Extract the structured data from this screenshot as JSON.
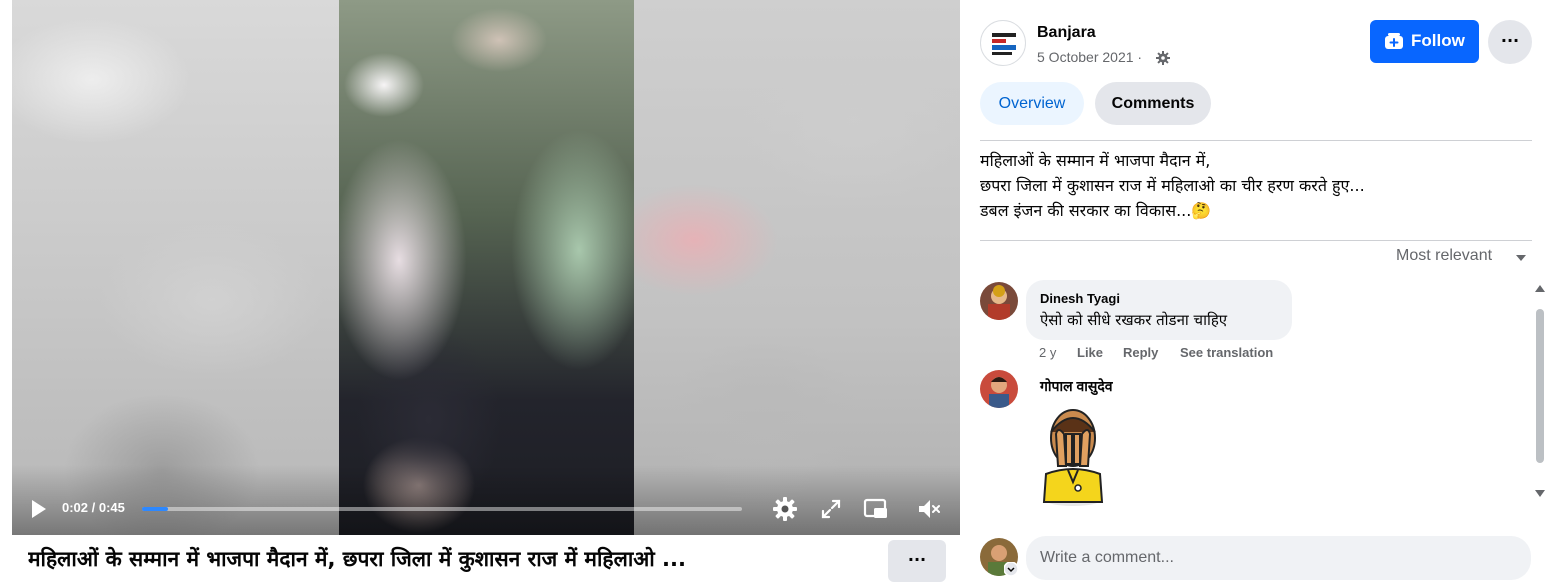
{
  "video": {
    "time_label": "0:02 / 0:45",
    "current_seconds": 2,
    "duration_seconds": 45,
    "progress_fraction": 0.044,
    "icons": [
      "play-icon",
      "settings-gear-icon",
      "fullscreen-icon",
      "picture-in-picture-icon",
      "muted-volume-icon"
    ]
  },
  "post": {
    "title": "महिलाओं के सम्मान में भाजपा मैदान में, छपरा जिला में कुशासन राज में महिलाओ ...",
    "title_more_label": "···",
    "page_name": "Banjara",
    "date": "5 October 2021 ·",
    "follow_label": "Follow",
    "more_label": "···",
    "caption_lines": [
      "महिलाओं के सम्मान में भाजपा मैदान में,",
      "छपरा जिला में कुशासन राज में महिलाओ का चीर हरण करते हुए...",
      "डबल इंजन की सरकार का विकास...🤔"
    ]
  },
  "tabs": {
    "overview": "Overview",
    "comments": "Comments"
  },
  "comments": {
    "sort_label": "Most relevant",
    "items": [
      {
        "author": "Dinesh Tyagi",
        "text": "ऐसो को सीधे रखकर तोडना चाहिए",
        "age": "2 y",
        "like": "Like",
        "reply": "Reply",
        "translate": "See translation"
      },
      {
        "author": "गोपाल वासुदेव",
        "sticker": "face-palm-sticker"
      }
    ],
    "compose_placeholder": "Write a comment..."
  },
  "colors": {
    "accent": "#0866ff",
    "tab_active_bg": "#ebf5ff",
    "tab_active_text": "#0064d1",
    "muted_text": "#65676b",
    "bubble_bg": "#f0f2f5",
    "progress": "#2d88ff"
  }
}
